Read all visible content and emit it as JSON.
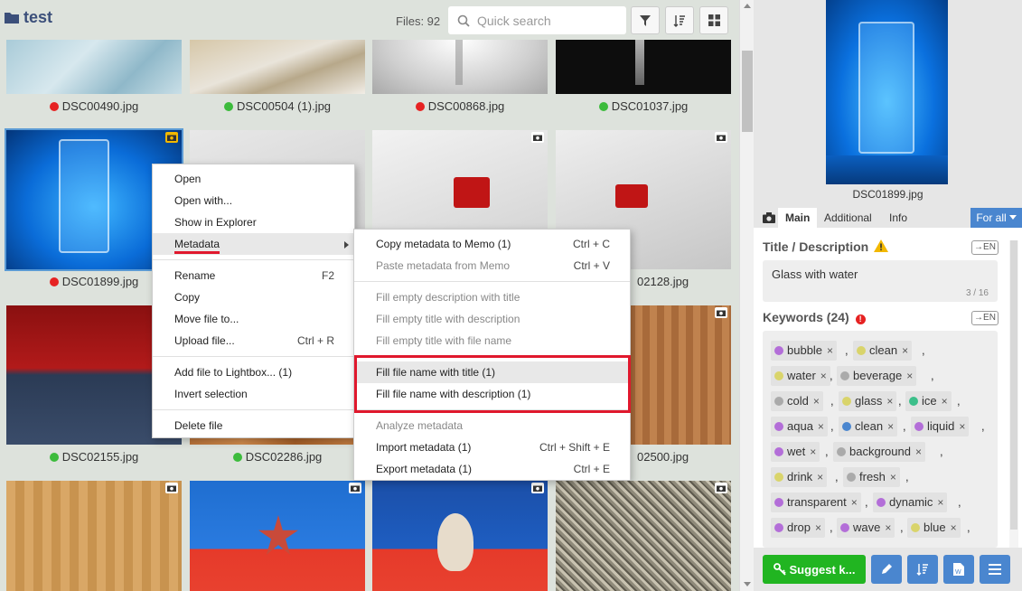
{
  "header": {
    "folder_name": "test",
    "files_count": "Files: 92",
    "search_placeholder": "Quick search"
  },
  "tiles": [
    {
      "name": "DSC00490.jpg",
      "status": "red"
    },
    {
      "name": "DSC00504 (1).jpg",
      "status": "green"
    },
    {
      "name": "DSC00868.jpg",
      "status": "red"
    },
    {
      "name": "DSC01037.jpg",
      "status": "green"
    },
    {
      "name": "DSC01899.jpg",
      "status": "red"
    },
    {
      "name": "02128.jpg",
      "status": ""
    },
    {
      "name": "DSC02155.jpg",
      "status": "green"
    },
    {
      "name": "DSC02286.jpg",
      "status": "green"
    },
    {
      "name": "02500.jpg",
      "status": ""
    }
  ],
  "context_menu": {
    "open": "Open",
    "open_with": "Open with...",
    "show_in_explorer": "Show in Explorer",
    "metadata": "Metadata",
    "rename": "Rename",
    "rename_shortcut": "F2",
    "copy": "Copy",
    "move_file_to": "Move file to...",
    "upload_file": "Upload file...",
    "upload_shortcut": "Ctrl + R",
    "add_to_lightbox": "Add file to Lightbox... (1)",
    "invert_selection": "Invert selection",
    "delete_file": "Delete file"
  },
  "metadata_submenu": {
    "copy_to_memo": "Copy metadata to Memo (1)",
    "copy_shortcut": "Ctrl + C",
    "paste_from_memo": "Paste metadata from Memo",
    "paste_shortcut": "Ctrl + V",
    "fill_desc_with_title": "Fill empty description with title",
    "fill_title_with_desc": "Fill empty title with description",
    "fill_title_with_filename": "Fill empty title with file name",
    "fill_filename_with_title": "Fill file name with title (1)",
    "fill_filename_with_desc": "Fill file name with description (1)",
    "analyze": "Analyze metadata",
    "import": "Import metadata (1)",
    "import_shortcut": "Ctrl + Shift + E",
    "export": "Export metadata (1)",
    "export_shortcut": "Ctrl + E"
  },
  "sidebar": {
    "preview_filename": "DSC01899.jpg",
    "tabs": {
      "main": "Main",
      "additional": "Additional",
      "info": "Info"
    },
    "for_all": "For all",
    "title_label": "Title / Description",
    "en_label": "EN",
    "description": "Glass with water",
    "desc_count": "3 / 16",
    "keywords_label": "Keywords (24)",
    "keywords": [
      {
        "text": "bubble",
        "color": "#b36ed8"
      },
      {
        "text": "clean",
        "color": "#d9d46b"
      },
      {
        "text": "water",
        "color": "#d9d46b"
      },
      {
        "text": "beverage",
        "color": "#aaaaaa"
      },
      {
        "text": "cold",
        "color": "#aaaaaa"
      },
      {
        "text": "glass",
        "color": "#d9d46b"
      },
      {
        "text": "ice",
        "color": "#3cbf8a"
      },
      {
        "text": "aqua",
        "color": "#b36ed8"
      },
      {
        "text": "clean",
        "color": "#4a86cf"
      },
      {
        "text": "liquid",
        "color": "#b36ed8"
      },
      {
        "text": "wet",
        "color": "#b36ed8"
      },
      {
        "text": "background",
        "color": "#aaaaaa"
      },
      {
        "text": "drink",
        "color": "#d9d46b"
      },
      {
        "text": "fresh",
        "color": "#aaaaaa"
      },
      {
        "text": "transparent",
        "color": "#b36ed8"
      },
      {
        "text": "dynamic",
        "color": "#b36ed8"
      },
      {
        "text": "drop",
        "color": "#b36ed8"
      },
      {
        "text": "wave",
        "color": "#b36ed8"
      },
      {
        "text": "blue",
        "color": "#d9d46b"
      }
    ],
    "suggest_button": "Suggest k..."
  },
  "colors": {
    "red": "#e62222",
    "green": "#3cbb3c",
    "accent": "#4a86cf",
    "suggest": "#21b521"
  }
}
